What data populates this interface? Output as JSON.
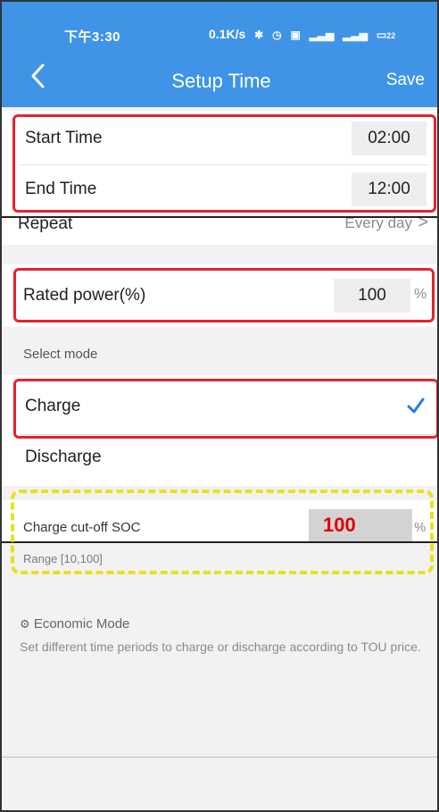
{
  "status_bar": {
    "time": "下午3:30",
    "net_speed": "0.1K/s",
    "icons": [
      "bluetooth-icon",
      "alarm-icon",
      "signal-icon",
      "battery-icon"
    ],
    "battery": "22"
  },
  "header": {
    "title": "Setup Time",
    "save_label": "Save",
    "back_icon": "chevron-left-icon"
  },
  "time_range": {
    "start_label": "Start Time",
    "start_value": "02:00",
    "end_label": "End Time",
    "end_value": "12:00"
  },
  "repeat": {
    "label": "Repeat",
    "value": "Every day"
  },
  "rated_power": {
    "label": "Rated power(%)",
    "value": "100",
    "unit": "%"
  },
  "mode": {
    "section_label": "Select mode",
    "options": [
      "Charge",
      "Discharge"
    ],
    "selected": "Charge"
  },
  "cutoff": {
    "label": "Charge cut-off SOC",
    "value": "100",
    "unit": "%",
    "range_text": "Range [10,100]"
  },
  "economic": {
    "title": "Economic Mode",
    "description": "Set different time periods to charge or discharge according to TOU price."
  },
  "colors": {
    "accent": "#3f94e8",
    "highlight_red": "#e8222a",
    "annotation_yellow": "#e7e21c",
    "check_blue": "#2a7de1"
  }
}
